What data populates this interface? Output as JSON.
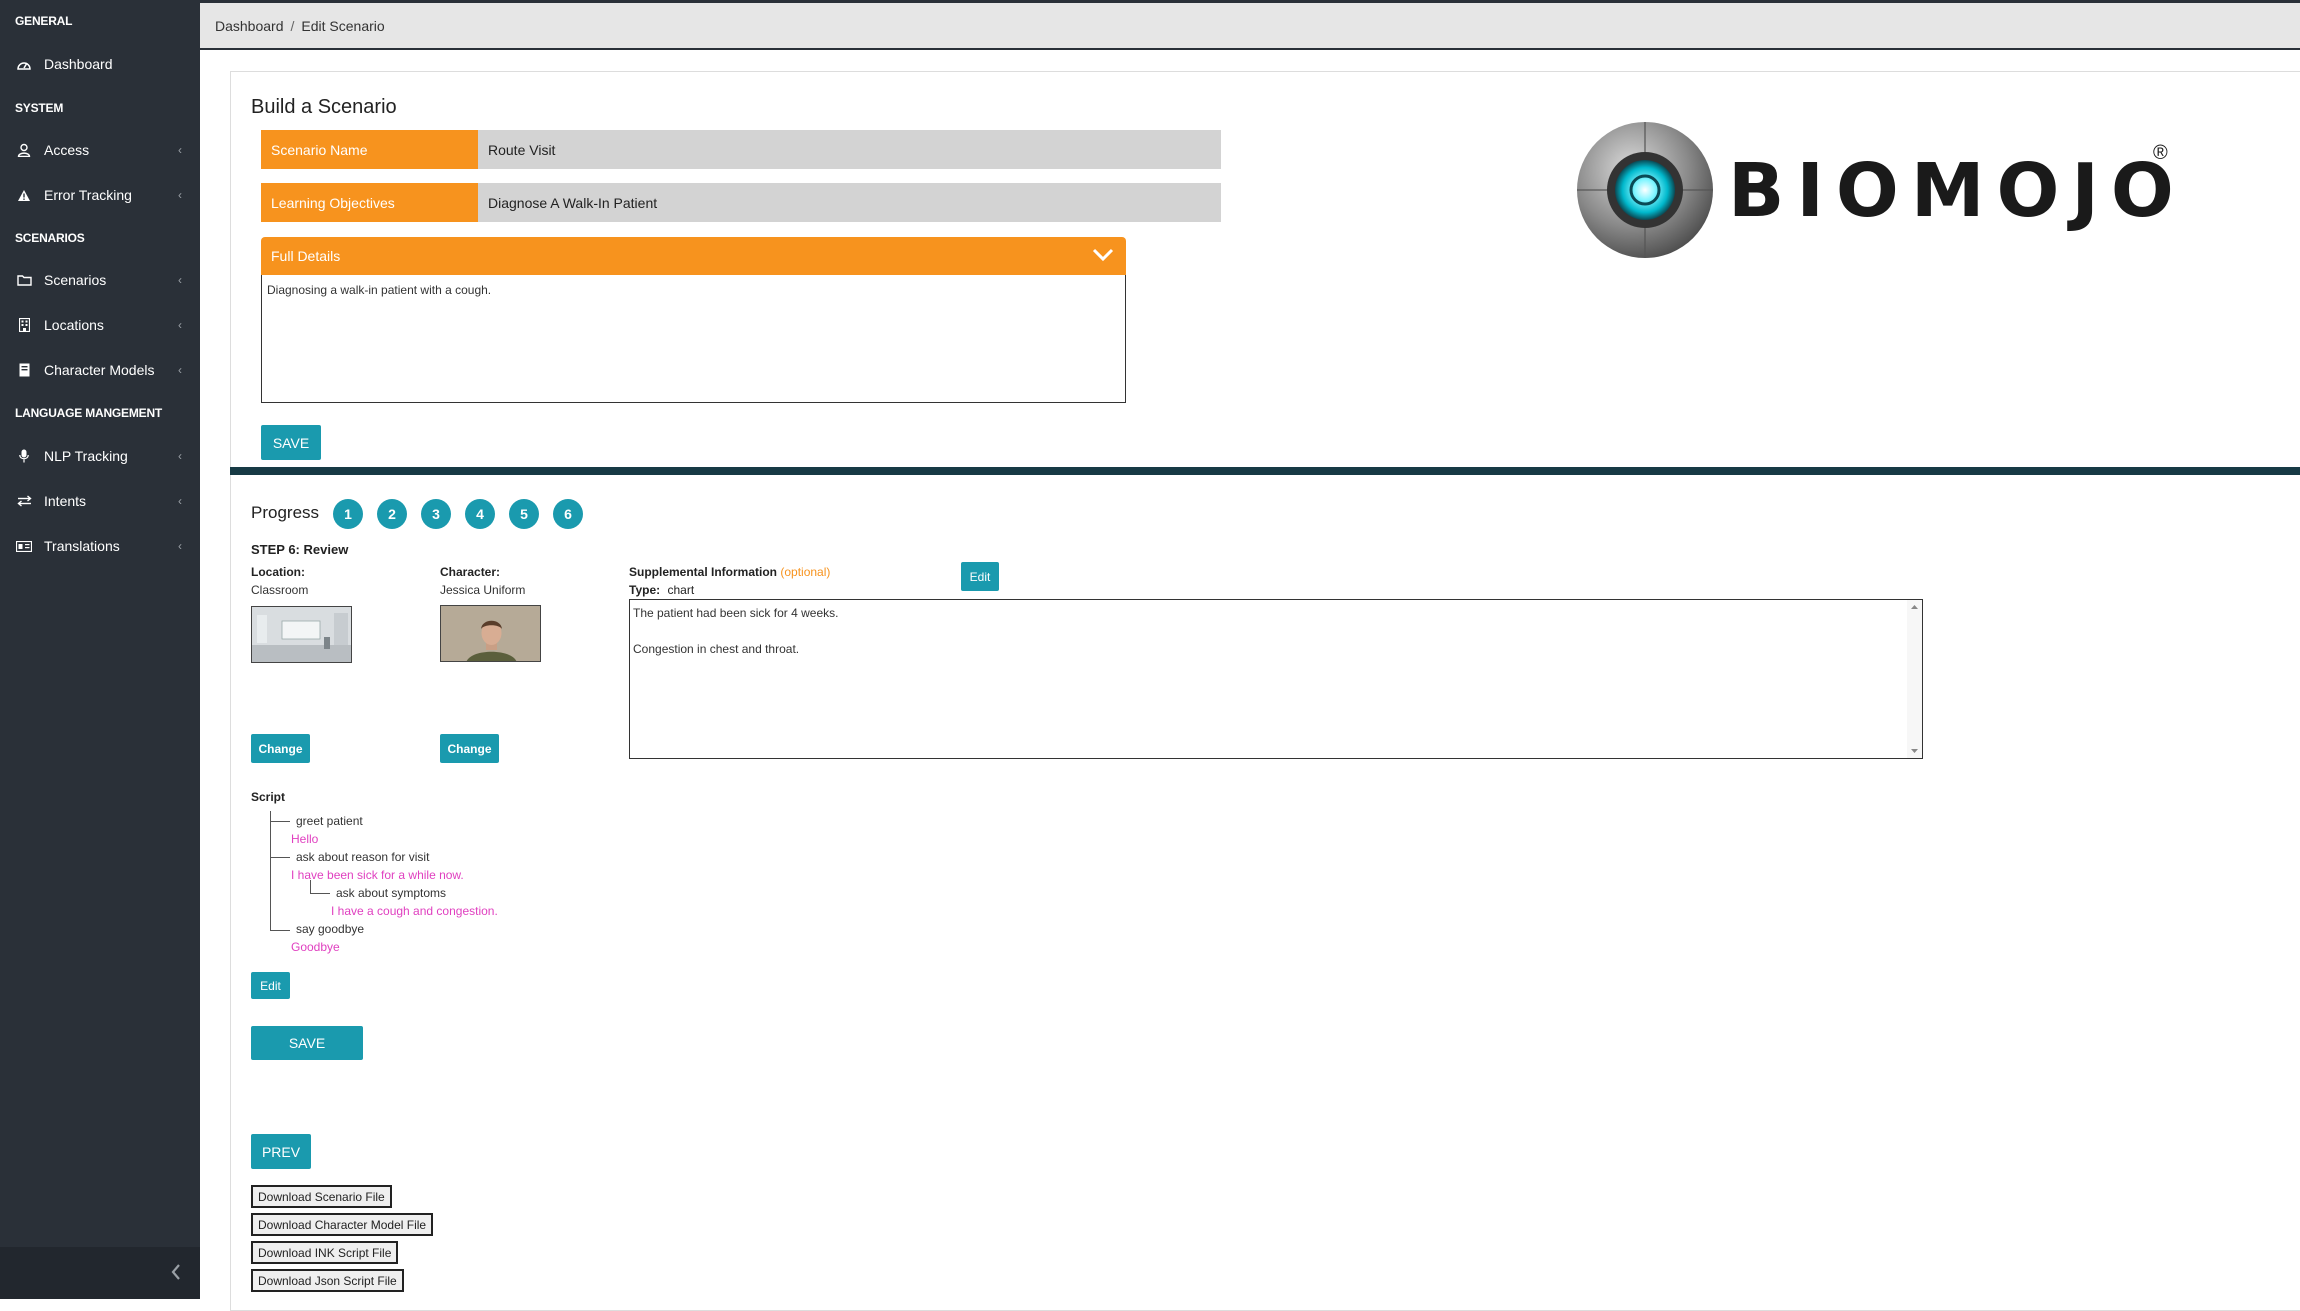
{
  "sidebar": {
    "sections": {
      "general": "GENERAL",
      "system": "SYSTEM",
      "scenarios": "SCENARIOS",
      "language": "LANGUAGE MANGEMENT"
    },
    "items": [
      {
        "label": "Dashboard",
        "icon": "dashboard-icon"
      },
      {
        "label": "Access",
        "icon": "user-icon"
      },
      {
        "label": "Error Tracking",
        "icon": "warning-icon"
      },
      {
        "label": "Scenarios",
        "icon": "folder-icon"
      },
      {
        "label": "Locations",
        "icon": "building-icon"
      },
      {
        "label": "Character Models",
        "icon": "book-icon"
      },
      {
        "label": "NLP Tracking",
        "icon": "microphone-icon"
      },
      {
        "label": "Intents",
        "icon": "exchange-icon"
      },
      {
        "label": "Translations",
        "icon": "language-icon"
      }
    ],
    "chevron": "‹",
    "colors": {
      "background": "#2a3038",
      "text": "#ffffff"
    }
  },
  "breadcrumb": {
    "home": "Dashboard",
    "separator": "/",
    "current": "Edit Scenario"
  },
  "build": {
    "title": "Build a Scenario",
    "scenario_name_label": "Scenario Name",
    "scenario_name_value": "Route Visit",
    "objectives_label": "Learning Objectives",
    "objectives_value": "Diagnose A Walk-In Patient",
    "details_label": "Full Details",
    "details_value": "Diagnosing a walk-in patient with a cough.",
    "save_label": "SAVE"
  },
  "logo": {
    "text": "BIOMOJO",
    "reg": "®"
  },
  "progress": {
    "label": "Progress",
    "steps": [
      "1",
      "2",
      "3",
      "4",
      "5",
      "6"
    ],
    "step_title": "STEP 6: Review"
  },
  "review": {
    "location_label": "Location:",
    "location_value": "Classroom",
    "character_label": "Character:",
    "character_value": "Jessica Uniform",
    "change_label": "Change",
    "supp_label": "Supplemental Information",
    "supp_optional": "(optional)",
    "type_label": "Type:",
    "type_value": "chart",
    "edit_label": "Edit",
    "supp_text": "The patient had been sick for 4 weeks.\n\nCongestion in chest and throat."
  },
  "script": {
    "label": "Script",
    "lines": [
      "greet patient",
      "Hello",
      "ask about reason for visit",
      "I have been sick for a while now.",
      "ask about symptoms",
      "I have a cough and congestion.",
      "say goodbye",
      "Goodbye"
    ],
    "edit_label": "Edit",
    "save_label": "SAVE"
  },
  "nav": {
    "prev_label": "PREV"
  },
  "downloads": [
    "Download Scenario File",
    "Download Character Model File",
    "Download INK Script File",
    "Download Json Script File"
  ],
  "colors": {
    "accent_orange": "#f7931e",
    "accent_teal": "#1a9aae",
    "script_pink": "#e040c0",
    "divider": "#173a45"
  }
}
